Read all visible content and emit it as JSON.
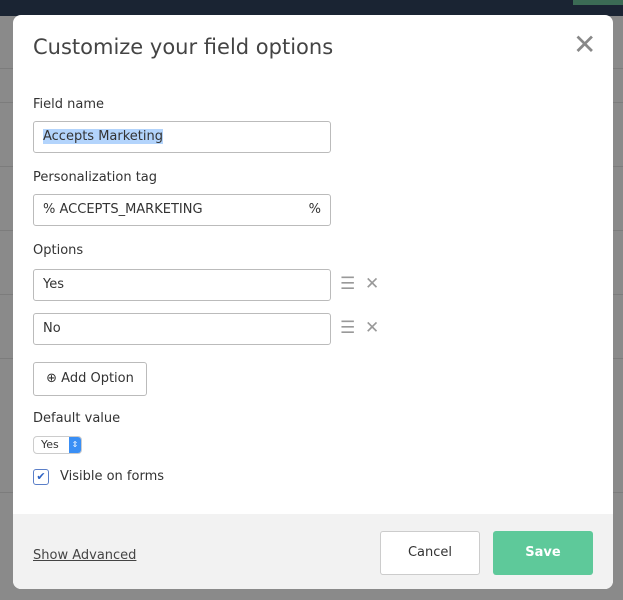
{
  "modal": {
    "title": "Customize your field options",
    "close_icon": "close-icon",
    "field_name": {
      "label": "Field name",
      "value": "Accepts Marketing"
    },
    "personalization_tag": {
      "label": "Personalization tag",
      "prefix": "%",
      "value": "ACCEPTS_MARKETING",
      "suffix": "%"
    },
    "options": {
      "label": "Options",
      "items": [
        {
          "value": "Yes"
        },
        {
          "value": "No"
        }
      ],
      "add_label": "Add Option"
    },
    "default_value": {
      "label": "Default value",
      "selected": "Yes"
    },
    "visible_on_forms": {
      "label": "Visible on forms",
      "checked": true
    },
    "footer": {
      "show_advanced": "Show Advanced",
      "cancel": "Cancel",
      "save": "Save"
    },
    "colors": {
      "save": "#5ec99a",
      "selection": "#b3d4fc",
      "header": "#1a2433"
    }
  }
}
